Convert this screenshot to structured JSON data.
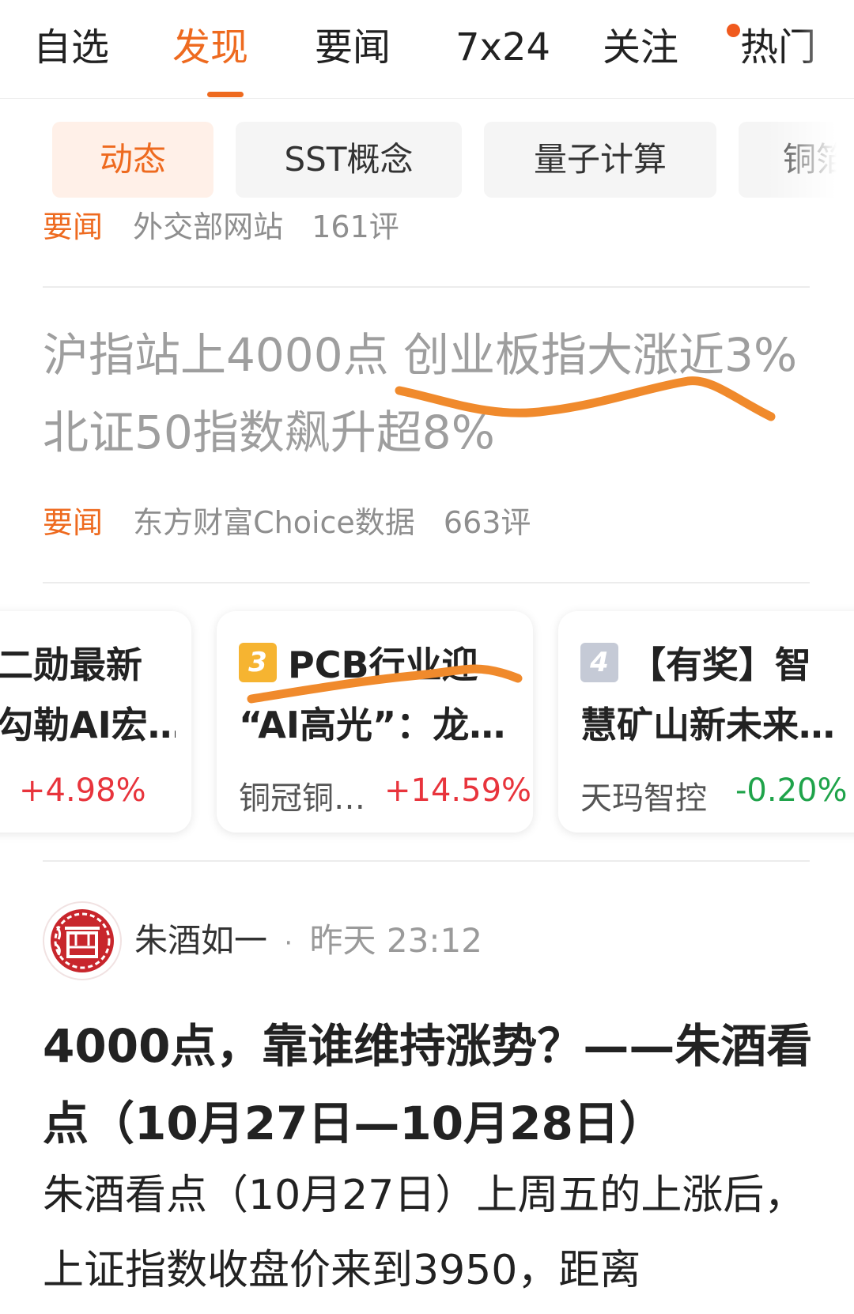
{
  "top_tabs": [
    {
      "label": "自选",
      "active": false
    },
    {
      "label": "发现",
      "active": true
    },
    {
      "label": "要闻",
      "active": false
    },
    {
      "label": "7x24",
      "active": false
    },
    {
      "label": "关注",
      "active": false,
      "has_dot": true
    },
    {
      "label": "热门",
      "active": false
    }
  ],
  "chips": [
    {
      "label": "动态",
      "active": true
    },
    {
      "label": "SST概念",
      "active": false
    },
    {
      "label": "量子计算",
      "active": false
    },
    {
      "label": "铜箔",
      "active": false
    }
  ],
  "news_items": [
    {
      "tag": "要闻",
      "source": "外交部网站",
      "comments": "161评"
    },
    {
      "headline": "沪指站上4000点 创业板指大涨近3% 北证50指数飙升超8%",
      "tag": "要闻",
      "source": "东方财富Choice数据",
      "comments": "663评"
    }
  ],
  "hot_cards": [
    {
      "rank": "",
      "title_line1": "二勋最新",
      "title_line2": "勾勒AI宏…",
      "stock": "",
      "change": "+4.98%",
      "direction": "up"
    },
    {
      "rank": "3",
      "title_line1": "PCB行业迎",
      "title_line2": "“AI高光”：龙…",
      "stock": "铜冠铜…",
      "change": "+14.59%",
      "direction": "up"
    },
    {
      "rank": "4",
      "title_line1": "【有奖】智",
      "title_line2": "慧矿山新未来…",
      "stock": "天玛智控",
      "change": "-0.20%",
      "direction": "down"
    }
  ],
  "post": {
    "author": "朱酒如一",
    "separator": "·",
    "time": "昨天 23:12",
    "avatar_icon": "seal-avatar-icon",
    "title": "4000点，靠谁维持涨势？——朱酒看点（10月27日—10月28日）",
    "body": "朱酒看点（10月27日）上周五的上涨后，上证指数收盘价来到3950，距离"
  },
  "colors": {
    "accent": "#ee6a1f",
    "up": "#e8343c",
    "down": "#1fa34a",
    "scribble": "#f08a2c"
  }
}
